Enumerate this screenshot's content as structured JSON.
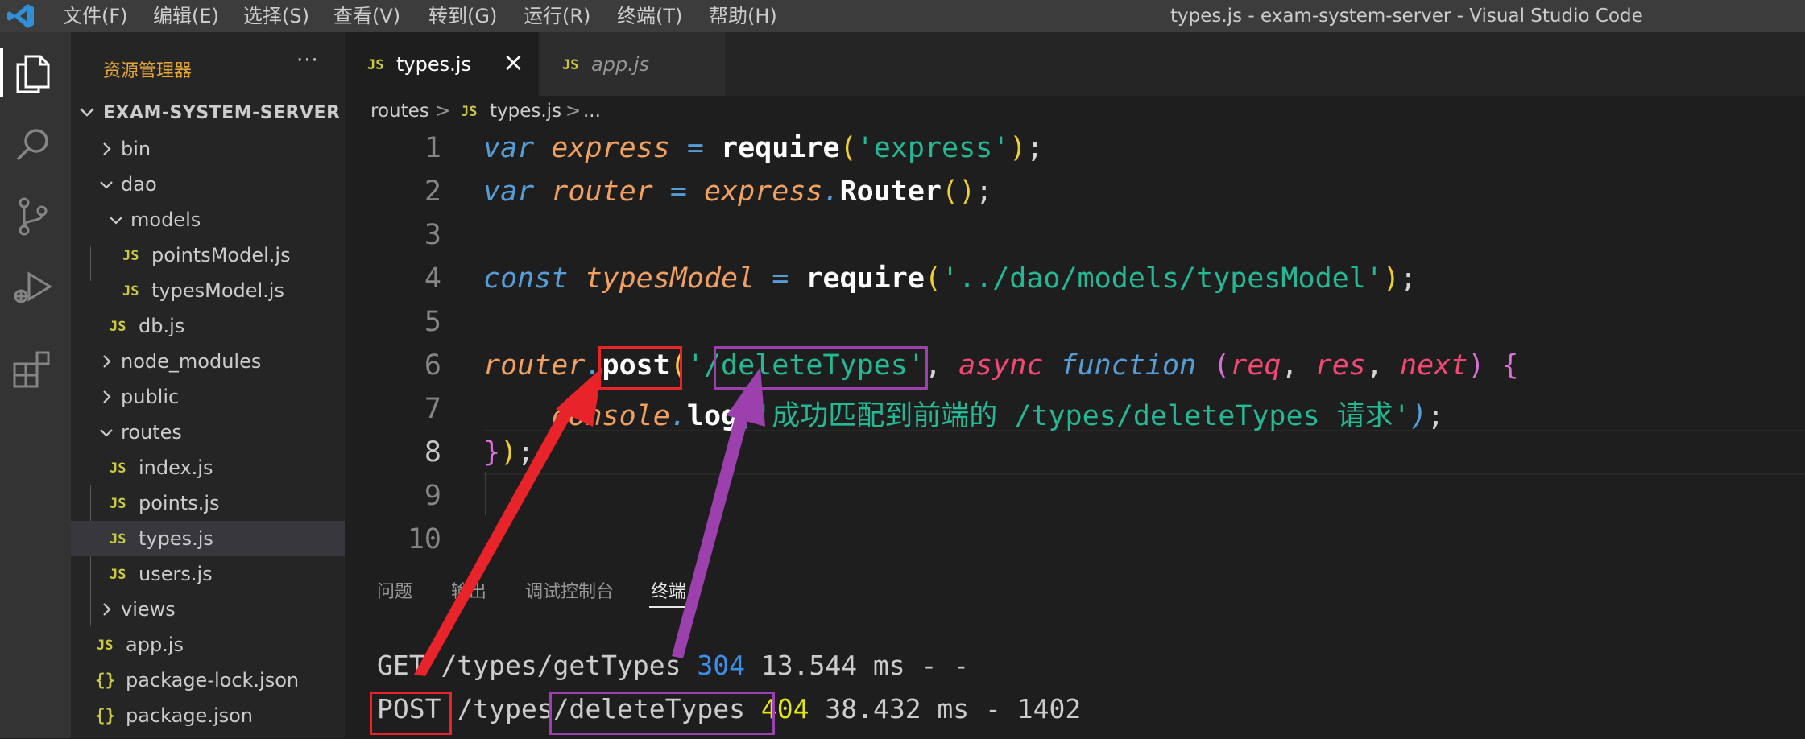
{
  "menu": [
    "文件(F)",
    "编辑(E)",
    "选择(S)",
    "查看(V)",
    "转到(G)",
    "运行(R)",
    "终端(T)",
    "帮助(H)"
  ],
  "window_title": "types.js - exam-system-server - Visual Studio Code",
  "activity_bar": [
    "files-icon",
    "search-icon",
    "source-control-icon",
    "run-debug-icon",
    "extensions-icon"
  ],
  "sidebar": {
    "title": "资源管理器",
    "more": "···",
    "project": "EXAM-SYSTEM-SERVER",
    "items": [
      {
        "label": "bin",
        "type": "folder",
        "expanded": false
      },
      {
        "label": "dao",
        "type": "folder",
        "expanded": true
      },
      {
        "label": "models",
        "type": "folder",
        "expanded": true
      },
      {
        "label": "pointsModel.js",
        "type": "js"
      },
      {
        "label": "typesModel.js",
        "type": "js"
      },
      {
        "label": "db.js",
        "type": "js"
      },
      {
        "label": "node_modules",
        "type": "folder",
        "expanded": false
      },
      {
        "label": "public",
        "type": "folder",
        "expanded": false
      },
      {
        "label": "routes",
        "type": "folder",
        "expanded": true
      },
      {
        "label": "index.js",
        "type": "js"
      },
      {
        "label": "points.js",
        "type": "js"
      },
      {
        "label": "types.js",
        "type": "js",
        "selected": true
      },
      {
        "label": "users.js",
        "type": "js"
      },
      {
        "label": "views",
        "type": "folder",
        "expanded": false
      },
      {
        "label": "app.js",
        "type": "js"
      },
      {
        "label": "package-lock.json",
        "type": "json"
      },
      {
        "label": "package.json",
        "type": "json"
      }
    ]
  },
  "tabs": [
    {
      "label": "types.js",
      "active": true,
      "close": "×",
      "icon": "JS"
    },
    {
      "label": "app.js",
      "active": false,
      "icon": "JS"
    }
  ],
  "breadcrumb": {
    "folder": "routes",
    "file": "types.js",
    "sep": ">",
    "ellipsis": "...",
    "icon": "JS"
  },
  "editor": {
    "line_numbers": [
      "1",
      "2",
      "3",
      "4",
      "5",
      "6",
      "7",
      "8",
      "9",
      "10"
    ],
    "active_line": "8",
    "lines": [
      {
        "var_kw": "var",
        "name": "express",
        "eq": "=",
        "fn": "require",
        "open": "(",
        "str": "'express'",
        "close": ")",
        "end": ";"
      },
      {
        "var_kw": "var",
        "name": "router",
        "eq": "=",
        "obj": "express",
        "dot": ".",
        "fn": "Router",
        "parens": "()",
        "end": ";"
      },
      {
        "var_kw": "const",
        "name": "typesModel",
        "eq": "=",
        "fn": "require",
        "open": "(",
        "str": "'../dao/models/typesModel'",
        "close": ")",
        "end": ";"
      },
      {
        "obj": "router",
        "dot": ".",
        "method": "post",
        "open": "(",
        "q1": "'",
        "path": "/deleteTypes",
        "q2": "'",
        "comma": ",",
        "async": "async",
        "function": "function",
        "popen": "(",
        "p1": "req",
        "c1": ",",
        "p2": "res",
        "c2": ",",
        "p3": "next",
        "pclose": ")",
        "brace": "{"
      },
      {
        "obj": "console",
        "dot": ".",
        "fn": "log",
        "open": "(",
        "str": "'成功匹配到前端的 /types/deleteTypes 请求'",
        "close": ")",
        "end": ";"
      },
      {
        "brace": "}",
        "close": ")",
        "end": ";"
      }
    ]
  },
  "panel": {
    "tabs": [
      "问题",
      "输出",
      "调试控制台",
      "终端"
    ],
    "active_tab": "终端",
    "terminal": [
      {
        "method": "GET",
        "path": "/types/getTypes",
        "status": "304",
        "rest": "13.544 ms - -"
      },
      {
        "method": "POST",
        "path_prefix": "/types",
        "path_suffix": "/deleteTypes",
        "status": "404",
        "rest": "38.432 ms - 1402"
      }
    ]
  },
  "colors": {
    "annotation_red": "#e8232a",
    "annotation_purple": "#9b40ad",
    "accent": "#007acc"
  }
}
